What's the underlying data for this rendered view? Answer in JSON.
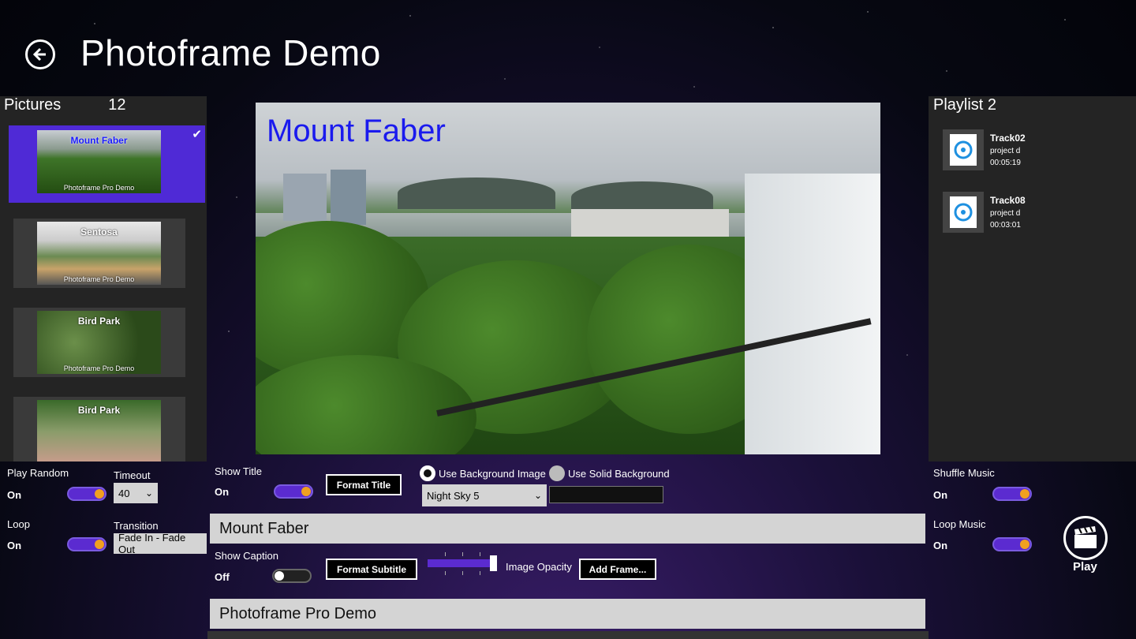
{
  "header": {
    "title": "Photoframe Demo"
  },
  "pictures": {
    "label": "Pictures",
    "count": "12",
    "items": [
      {
        "title": "Mount Faber",
        "subtitle": "Photoframe Pro Demo",
        "selected": true
      },
      {
        "title": "Sentosa",
        "subtitle": "Photoframe Pro Demo",
        "selected": false
      },
      {
        "title": "Bird Park",
        "subtitle": "Photoframe Pro Demo",
        "selected": false
      },
      {
        "title": "Bird Park",
        "subtitle": "",
        "selected": false
      }
    ]
  },
  "preview": {
    "title": "Mount Faber"
  },
  "playlist": {
    "label": "Playlist 2",
    "tracks": [
      {
        "name": "Track02",
        "project": "project d",
        "duration": "00:05:19"
      },
      {
        "name": "Track08",
        "project": "project d",
        "duration": "00:03:01"
      }
    ]
  },
  "settings": {
    "play_random": {
      "label": "Play Random",
      "value": "On"
    },
    "timeout": {
      "label": "Timeout",
      "value": "40"
    },
    "loop": {
      "label": "Loop",
      "value": "On"
    },
    "transition": {
      "label": "Transition",
      "value": "Fade In - Fade Out"
    },
    "show_title": {
      "label": "Show Title",
      "value": "On"
    },
    "format_title": "Format Title",
    "use_bg_image": "Use Background Image",
    "use_solid_bg": "Use Solid Background",
    "background": "Night Sky 5",
    "title_text": "Mount Faber",
    "show_caption": {
      "label": "Show Caption",
      "value": "Off"
    },
    "format_subtitle": "Format Subtitle",
    "image_opacity": {
      "label": "Image Opacity",
      "value": 1.0
    },
    "add_frame": "Add Frame...",
    "caption_text": "Photoframe Pro Demo",
    "shuffle_music": {
      "label": "Shuffle Music",
      "value": "On"
    },
    "loop_music": {
      "label": "Loop Music",
      "value": "On"
    },
    "play": "Play"
  },
  "colors": {
    "accent": "#5b2bd0",
    "toggle_knob": "#f0a020",
    "title_blue": "#1a1aee"
  },
  "icons": {
    "back": "arrow-left-icon",
    "check": "check-icon",
    "music": "music-file-icon",
    "play": "clapperboard-icon"
  }
}
